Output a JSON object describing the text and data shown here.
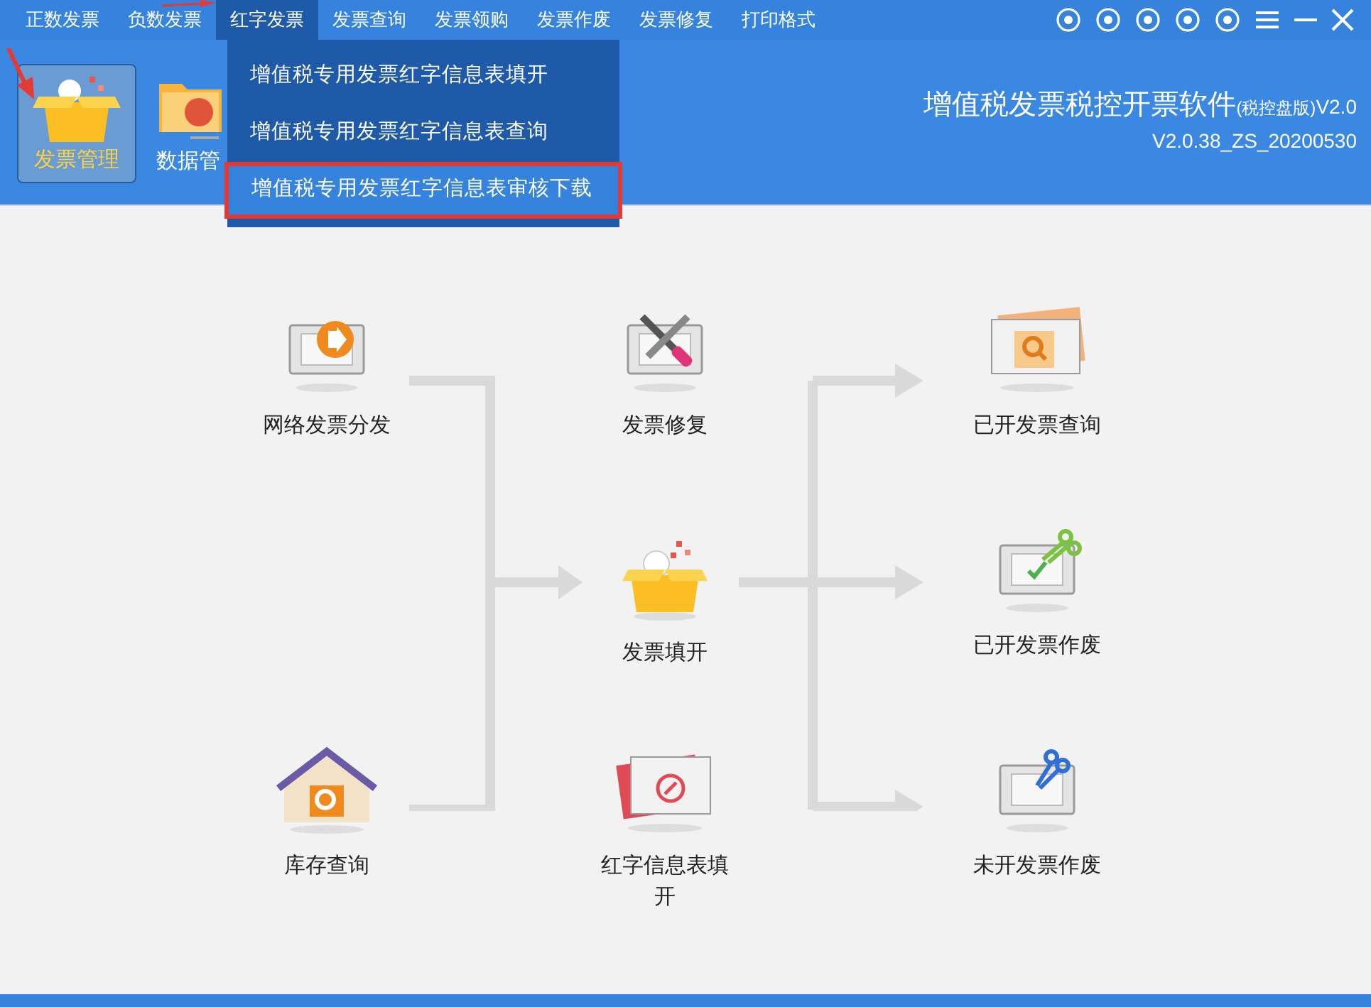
{
  "menu_bar": [
    {
      "label": "正数发票",
      "selected": false
    },
    {
      "label": "负数发票",
      "selected": false
    },
    {
      "label": "红字发票",
      "selected": true
    },
    {
      "label": "发票查询",
      "selected": false
    },
    {
      "label": "发票领购",
      "selected": false
    },
    {
      "label": "发票作废",
      "selected": false
    },
    {
      "label": "发票修复",
      "selected": false
    },
    {
      "label": "打印格式",
      "selected": false
    }
  ],
  "dropdown": [
    {
      "label": "增值税专用发票红字信息表填开",
      "highlighted": false
    },
    {
      "label": "增值税专用发票红字信息表查询",
      "highlighted": false
    },
    {
      "label": "增值税专用发票红字信息表审核下载",
      "highlighted": true
    }
  ],
  "toolbar": [
    {
      "label": "发票管理",
      "selected": true,
      "kind": "box"
    },
    {
      "label": "数据管",
      "selected": false,
      "kind": "folder"
    }
  ],
  "app_title": {
    "name": "增值税发票税控开票软件",
    "edition": "(税控盘版)",
    "version_short": "V2.0",
    "version": "V2.0.38_ZS_20200530"
  },
  "nodes": [
    {
      "label": "网络发票分发",
      "kind": "send"
    },
    {
      "label": "库存查询",
      "kind": "house"
    },
    {
      "label": "发票修复",
      "kind": "tools"
    },
    {
      "label": "发票填开",
      "kind": "box"
    },
    {
      "label": "红字信息表填开",
      "kind": "red"
    },
    {
      "label": "已开发票查询",
      "kind": "search"
    },
    {
      "label": "已开发票作废",
      "kind": "scissors-green"
    },
    {
      "label": "未开发票作废",
      "kind": "scissors-blue"
    }
  ]
}
